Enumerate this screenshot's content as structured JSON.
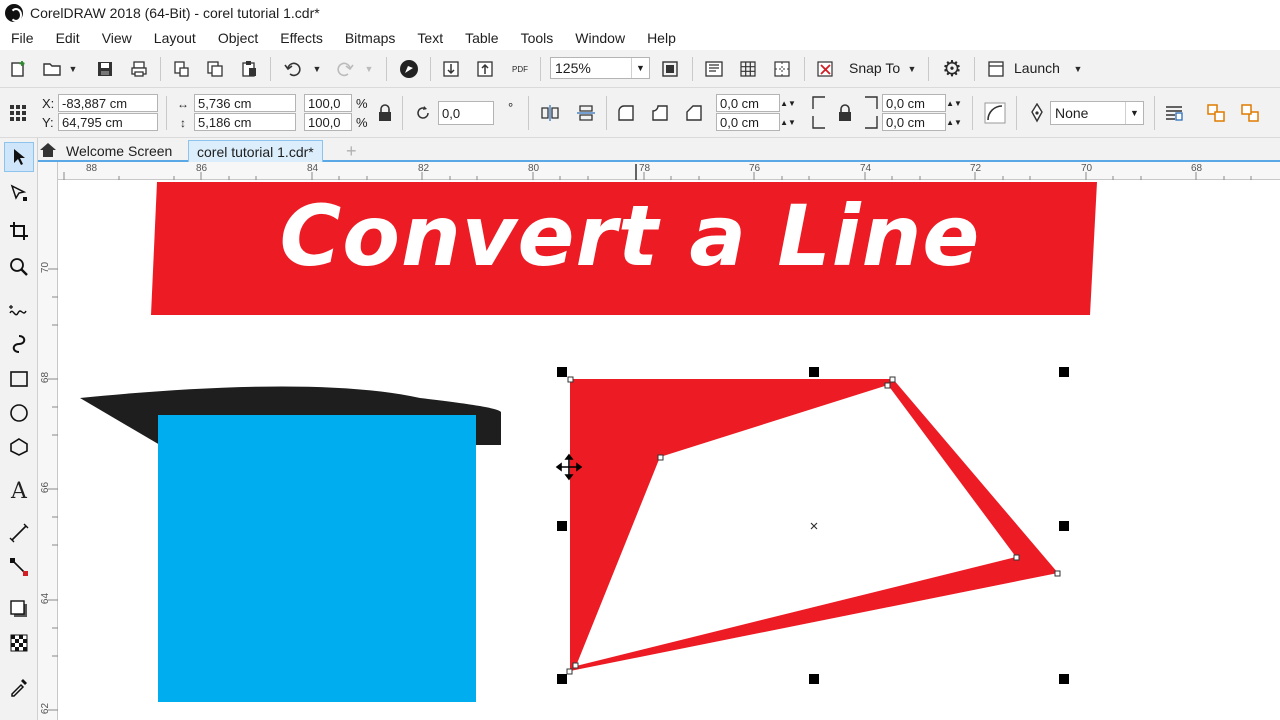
{
  "window": {
    "title": "CorelDRAW 2018 (64-Bit) - corel tutorial 1.cdr*"
  },
  "menu": [
    {
      "label": "File",
      "name": "menu-file"
    },
    {
      "label": "Edit",
      "name": "menu-edit"
    },
    {
      "label": "View",
      "name": "menu-view"
    },
    {
      "label": "Layout",
      "name": "menu-layout"
    },
    {
      "label": "Object",
      "name": "menu-object"
    },
    {
      "label": "Effects",
      "name": "menu-effects"
    },
    {
      "label": "Bitmaps",
      "name": "menu-bitmaps"
    },
    {
      "label": "Text",
      "name": "menu-text"
    },
    {
      "label": "Table",
      "name": "menu-table"
    },
    {
      "label": "Tools",
      "name": "menu-tools"
    },
    {
      "label": "Window",
      "name": "menu-window"
    },
    {
      "label": "Help",
      "name": "menu-help"
    }
  ],
  "standard_toolbar": {
    "zoom_value": "125%",
    "snap_to_label": "Snap To",
    "launch_label": "Launch",
    "pdf_label": "PDF"
  },
  "property_bar": {
    "x_label": "X:",
    "y_label": "Y:",
    "x_value": "-83,887 cm",
    "y_value": "64,795 cm",
    "width_value": "5,736 cm",
    "height_value": "5,186 cm",
    "scale_x": "100,0",
    "scale_y": "100,0",
    "percent": "%",
    "rotation": "0,0",
    "degree": "°",
    "corner_1": "0,0 cm",
    "corner_2": "0,0 cm",
    "corner_3": "0,0 cm",
    "corner_4": "0,0 cm",
    "outline_width": "None"
  },
  "tabs": [
    {
      "label": "Welcome Screen",
      "active": false
    },
    {
      "label": "corel tutorial 1.cdr*",
      "active": true
    }
  ],
  "new_tab_label": "+",
  "ruler": {
    "horizontal": [
      "88",
      "86",
      "84",
      "82",
      "80",
      "78",
      "76",
      "74",
      "72",
      "70",
      "68"
    ],
    "vertical": [
      "70",
      "68",
      "66",
      "64",
      "62"
    ]
  },
  "canvas": {
    "banner_text": "Convert a Line",
    "colors": {
      "banner": "#ed1c24",
      "shape_red": "#ed1c24",
      "rect_blue": "#00aeef",
      "dark_band": "#1e1e1e"
    }
  },
  "tools": [
    "pick-tool-icon",
    "shape-tool-icon",
    "crop-tool-icon",
    "zoom-tool-icon",
    "freehand-tool-icon",
    "artistic-media-icon",
    "rectangle-tool-icon",
    "ellipse-tool-icon",
    "polygon-tool-icon",
    "text-tool-icon",
    "parallel-dimension-icon",
    "connector-tool-icon",
    "drop-shadow-icon",
    "transparency-icon",
    "eyedropper-icon"
  ]
}
